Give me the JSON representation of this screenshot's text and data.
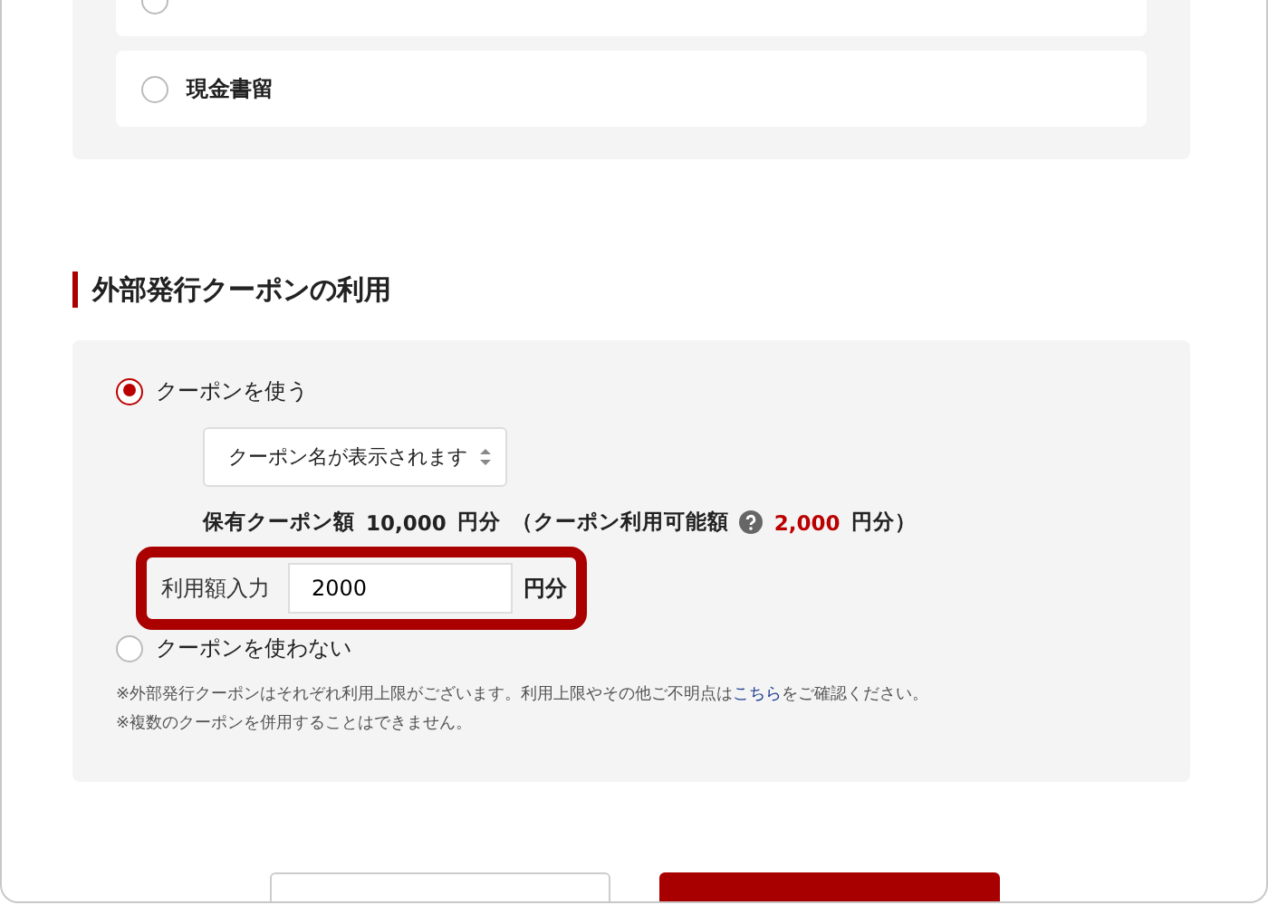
{
  "payment_options": [
    {
      "selected": false,
      "clipped": true
    },
    {
      "label": "現金書留",
      "selected": false,
      "clipped": false
    }
  ],
  "coupon_section": {
    "heading": "外部発行クーポンの利用",
    "options": [
      {
        "label": "クーポンを使う",
        "selected": true
      },
      {
        "label": "クーポンを使わない",
        "selected": false
      }
    ],
    "coupon_select": "クーポン名が表示されます",
    "balance": {
      "label": "保有クーポン額",
      "amount": "10,000",
      "unit": "円分",
      "available_label": "（クーポン利用可能額",
      "available_amount": "2,000",
      "available_unit": "円分）"
    },
    "amount_input": {
      "label": "利用額入力",
      "value": "2000",
      "unit": "円分"
    },
    "notes": [
      {
        "before": "※外部発行クーポンはそれぞれ利用上限がございます。利用上限やその他ご不明点は",
        "link": "こちら",
        "after": "をご確認ください。"
      },
      {
        "before": "※複数のクーポンを併用することはできません。"
      }
    ]
  }
}
